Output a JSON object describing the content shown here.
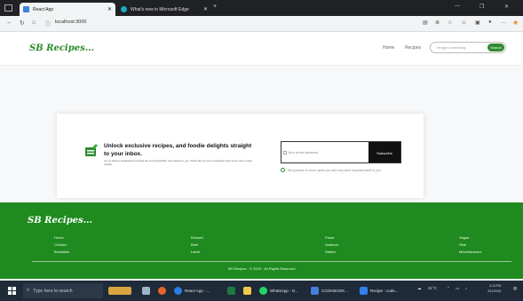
{
  "browser": {
    "tabs": [
      {
        "title": "React App",
        "active": true
      },
      {
        "title": "What's new in Microsoft Edge",
        "active": false
      }
    ],
    "new_tab_icon": "plus-icon",
    "url": "localhost:3000",
    "window_controls": [
      "—",
      "❐",
      "✕"
    ]
  },
  "site": {
    "logo": "SB Recipes...",
    "nav": [
      "Home",
      "Recipes"
    ],
    "search_placeholder": "Hi type something...",
    "search_button": "Search",
    "brand_color": "#1f8a1f"
  },
  "newsletter": {
    "title": "Unlock exclusive recipes, and foodie delights straight to your inbox.",
    "description": "Let us deliver handpicked cooking tips and irresistible new dishes to you. Subscribe for your newsletter and never miss a tasty update.",
    "email_placeholder": "Your email address",
    "subscribe_button": "Subscribe",
    "privacy_note": "We promise to never spam you and only send important stuff to you."
  },
  "footer": {
    "logo": "SB Recipes...",
    "columns": [
      [
        "Home",
        "Chicken",
        "Breakfast"
      ],
      [
        "Dessert",
        "Beef",
        "Lamb"
      ],
      [
        "Pasta",
        "Seafood",
        "Starter"
      ],
      [
        "Vegan",
        "Side",
        "Miscellaneous"
      ]
    ],
    "copyright": "SB Recipes · © 2023 · All Rights Reserved"
  },
  "taskbar": {
    "search_placeholder": "Type here to search",
    "items": [
      {
        "label": "React App - ...",
        "icon_color": "#2a7de1"
      },
      {
        "label": "WhatsApp - G...",
        "icon_color": "#25d366"
      },
      {
        "label": "COOKBOOK...",
        "icon_color": "#4a7dd9"
      },
      {
        "label": "Recipe - code...",
        "icon_color": "#2f80ed"
      }
    ],
    "temperature": "31°C",
    "time": "3:13 PM",
    "date": "3/11/2025"
  }
}
